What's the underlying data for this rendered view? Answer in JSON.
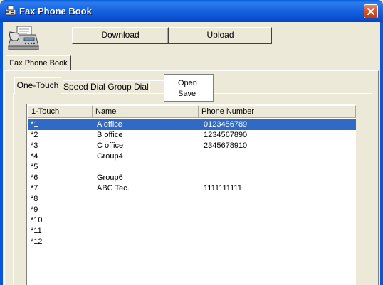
{
  "window": {
    "title": "Fax Phone Book",
    "app_icon": "fax-app-icon",
    "close_icon": "close-icon"
  },
  "toolbar": {
    "download_label": "Download",
    "upload_label": "Upload",
    "fax_icon": "fax-machine-icon"
  },
  "outer_tab": {
    "label": "Fax Phone Book"
  },
  "tabs": [
    {
      "label": "One-Touch",
      "selected": true
    },
    {
      "label": "Speed Dial",
      "selected": false
    },
    {
      "label": "Group Dial",
      "selected": false
    }
  ],
  "popup_menu": {
    "items": [
      "Open",
      "Save"
    ]
  },
  "list": {
    "columns": [
      "1-Touch",
      "Name",
      "Phone Number"
    ],
    "rows": [
      {
        "id": "*1",
        "name": "A office",
        "phone": "0123456789",
        "selected": true
      },
      {
        "id": "*2",
        "name": "B office",
        "phone": "1234567890",
        "selected": false
      },
      {
        "id": "*3",
        "name": "C office",
        "phone": "2345678910",
        "selected": false
      },
      {
        "id": "*4",
        "name": "Group4",
        "phone": "",
        "selected": false
      },
      {
        "id": "*5",
        "name": "",
        "phone": "",
        "selected": false
      },
      {
        "id": "*6",
        "name": "Group6",
        "phone": "",
        "selected": false
      },
      {
        "id": "*7",
        "name": "ABC Tec.",
        "phone": "1111111111",
        "selected": false
      },
      {
        "id": "*8",
        "name": "",
        "phone": "",
        "selected": false
      },
      {
        "id": "*9",
        "name": "",
        "phone": "",
        "selected": false
      },
      {
        "id": "*10",
        "name": "",
        "phone": "",
        "selected": false
      },
      {
        "id": "*11",
        "name": "",
        "phone": "",
        "selected": false
      },
      {
        "id": "*12",
        "name": "",
        "phone": "",
        "selected": false
      }
    ]
  },
  "colors": {
    "titlebar": "#0a5fd8",
    "selection": "#316ac5",
    "face": "#ece9d8"
  }
}
